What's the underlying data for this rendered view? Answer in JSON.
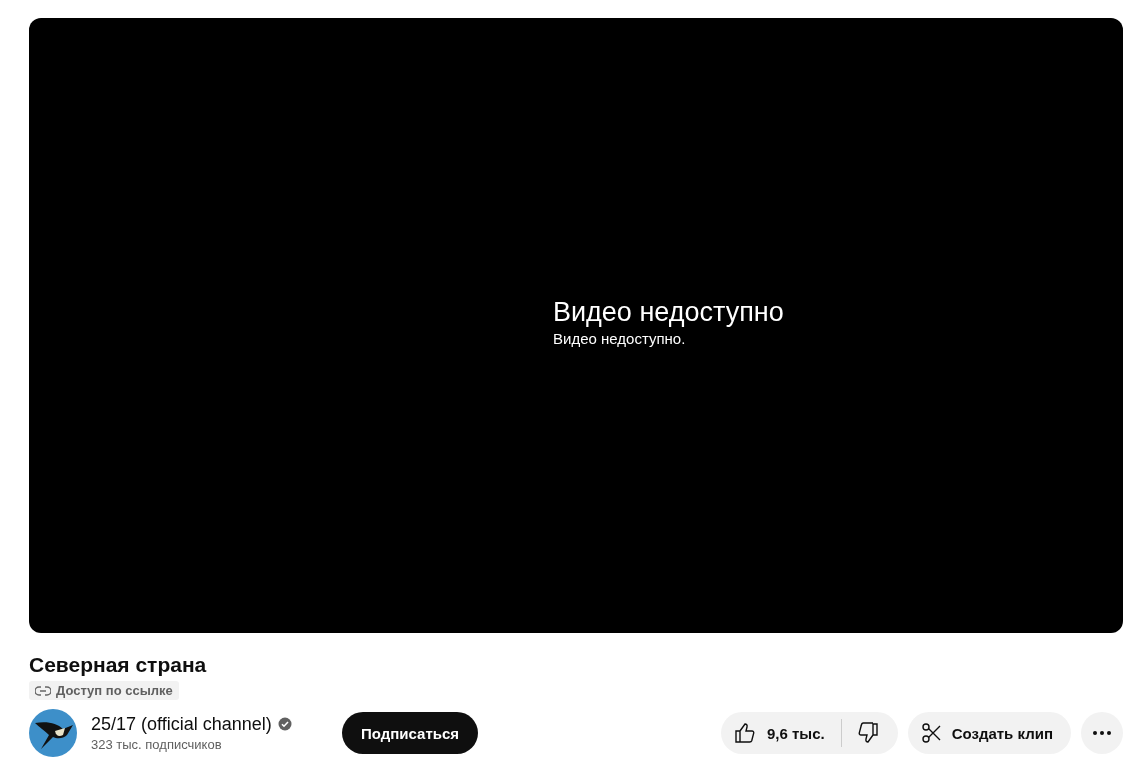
{
  "player": {
    "error_title": "Видео недоступно",
    "error_message": "Видео недоступно."
  },
  "video": {
    "title": "Северная страна",
    "visibility": "Доступ по ссылке"
  },
  "channel": {
    "name": "25/17 (official channel)",
    "verified": true,
    "subscribers": "323 тыс. подписчиков",
    "subscribe_label": "Подписаться"
  },
  "actions": {
    "likes": "9,6 тыс.",
    "clip_label": "Создать клип"
  }
}
